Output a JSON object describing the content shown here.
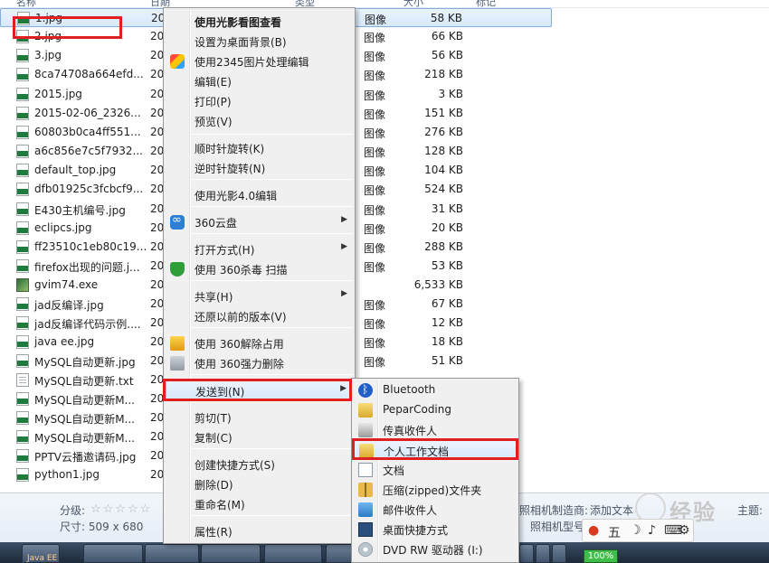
{
  "file_list": {
    "columns": [
      "名称",
      "日期",
      "类型",
      "大小",
      "标记"
    ],
    "files": [
      {
        "name": "1.jpg",
        "date": "20",
        "type": "图像",
        "size": "58 KB",
        "icon": "jpeg-file-icon"
      },
      {
        "name": "2.jpg",
        "date": "20",
        "type": "图像",
        "size": "66 KB",
        "icon": "jpeg-file-icon"
      },
      {
        "name": "3.jpg",
        "date": "20",
        "type": "图像",
        "size": "56 KB",
        "icon": "jpeg-file-icon"
      },
      {
        "name": "8ca74708a664efd...",
        "date": "20",
        "type": "图像",
        "size": "218 KB",
        "icon": "jpeg-file-icon"
      },
      {
        "name": "2015.jpg",
        "date": "20",
        "type": "图像",
        "size": "3 KB",
        "icon": "jpeg-file-icon"
      },
      {
        "name": "2015-02-06_2326...",
        "date": "20",
        "type": "图像",
        "size": "151 KB",
        "icon": "jpeg-file-icon"
      },
      {
        "name": "60803b0ca4ff551...",
        "date": "20",
        "type": "图像",
        "size": "276 KB",
        "icon": "jpeg-file-icon"
      },
      {
        "name": "a6c856e7c5f7932...",
        "date": "20",
        "type": "图像",
        "size": "128 KB",
        "icon": "jpeg-file-icon"
      },
      {
        "name": "default_top.jpg",
        "date": "20",
        "type": "图像",
        "size": "104 KB",
        "icon": "jpeg-file-icon"
      },
      {
        "name": "dfb01925c3fcbcf9...",
        "date": "20",
        "type": "图像",
        "size": "524 KB",
        "icon": "jpeg-file-icon"
      },
      {
        "name": "E430主机编号.jpg",
        "date": "20",
        "type": "图像",
        "size": "31 KB",
        "icon": "jpeg-file-icon"
      },
      {
        "name": "eclipcs.jpg",
        "date": "20",
        "type": "图像",
        "size": "20 KB",
        "icon": "jpeg-file-icon"
      },
      {
        "name": "ff23510c1eb80c19...",
        "date": "20",
        "type": "图像",
        "size": "288 KB",
        "icon": "jpeg-file-icon"
      },
      {
        "name": "firefox出现的问题.j...",
        "date": "20",
        "type": "图像",
        "size": "53 KB",
        "icon": "jpeg-file-icon"
      },
      {
        "name": "gvim74.exe",
        "date": "20",
        "type": "",
        "size": "6,533 KB",
        "icon": "exe-file-icon"
      },
      {
        "name": "jad反编译.jpg",
        "date": "20",
        "type": "图像",
        "size": "67 KB",
        "icon": "jpeg-file-icon"
      },
      {
        "name": "jad反编译代码示例....",
        "date": "20",
        "type": "图像",
        "size": "12 KB",
        "icon": "jpeg-file-icon"
      },
      {
        "name": "java ee.jpg",
        "date": "20",
        "type": "图像",
        "size": "18 KB",
        "icon": "jpeg-file-icon"
      },
      {
        "name": "MySQL自动更新.jpg",
        "date": "20",
        "type": "图像",
        "size": "51 KB",
        "icon": "jpeg-file-icon"
      },
      {
        "name": "MySQL自动更新.txt",
        "date": "20",
        "type": "",
        "size": "",
        "icon": "txt-file-icon"
      },
      {
        "name": "MySQL自动更新M...",
        "date": "20",
        "type": "",
        "size": "",
        "icon": "jpeg-file-icon"
      },
      {
        "name": "MySQL自动更新M...",
        "date": "20",
        "type": "",
        "size": "",
        "icon": "jpeg-file-icon"
      },
      {
        "name": "MySQL自动更新M...",
        "date": "20",
        "type": "",
        "size": "",
        "icon": "jpeg-file-icon"
      },
      {
        "name": "PPTV云播邀请码.jpg",
        "date": "20",
        "type": "",
        "size": "",
        "icon": "jpeg-file-icon"
      },
      {
        "name": "python1.jpg",
        "date": "20",
        "type": "",
        "size": "",
        "icon": "jpeg-file-icon"
      }
    ]
  },
  "details": {
    "rating_label": "分级:",
    "stars": "☆☆☆☆☆",
    "dimensions_label": "尺寸: 509 x 680",
    "camera_maker": "照相机制造商:",
    "camera_maker_value": "添加文本",
    "camera_model": "照相机型号:",
    "subject_label": "主题:"
  },
  "context_menu": {
    "items": [
      {
        "label": "使用光影看图查看",
        "bold": true
      },
      {
        "label": "设置为桌面背景(B)"
      },
      {
        "label": "使用2345图片处理编辑",
        "icon": "image-edit-icon"
      },
      {
        "label": "编辑(E)"
      },
      {
        "label": "打印(P)"
      },
      {
        "label": "预览(V)"
      },
      {
        "label": "顺时针旋转(K)"
      },
      {
        "label": "逆时针旋转(N)"
      },
      {
        "label": "使用光影4.0编辑"
      },
      {
        "label": "360云盘",
        "icon": "cloud-disk-icon",
        "submenu": true
      },
      {
        "label": "打开方式(H)",
        "submenu": true
      },
      {
        "label": "使用 360杀毒 扫描",
        "icon": "antivirus-shield-icon"
      },
      {
        "label": "共享(H)",
        "submenu": true
      },
      {
        "label": "还原以前的版本(V)"
      },
      {
        "label": "使用 360解除占用",
        "icon": "unlock-icon"
      },
      {
        "label": "使用 360强力删除",
        "icon": "shredder-icon"
      },
      {
        "label": "发送到(N)",
        "submenu": true,
        "highlighted": true
      },
      {
        "label": "剪切(T)"
      },
      {
        "label": "复制(C)"
      },
      {
        "label": "创建快捷方式(S)"
      },
      {
        "label": "删除(D)"
      },
      {
        "label": "重命名(M)"
      },
      {
        "label": "属性(R)"
      }
    ]
  },
  "send_to_menu": {
    "items": [
      {
        "label": "Bluetooth",
        "icon": "bluetooth-icon"
      },
      {
        "label": "PeparCoding",
        "icon": "folder-icon"
      },
      {
        "label": "传真收件人",
        "icon": "fax-icon"
      },
      {
        "label": "个人工作文档",
        "icon": "folder-icon",
        "highlighted": true
      },
      {
        "label": "文档",
        "icon": "document-icon"
      },
      {
        "label": "压缩(zipped)文件夹",
        "icon": "zip-folder-icon"
      },
      {
        "label": "邮件收件人",
        "icon": "mail-icon"
      },
      {
        "label": "桌面快捷方式",
        "icon": "desktop-icon"
      },
      {
        "label": "DVD RW 驱动器 (I:)",
        "icon": "dvd-drive-icon"
      }
    ]
  },
  "taskbar": {
    "java_ee_label": "Java EE",
    "battery": "100%"
  },
  "ime_bar": {
    "mode": "五"
  },
  "watermark": {
    "text": "经验"
  },
  "colors": {
    "highlight_red": "#e02020",
    "selection_blue": "#d6e8fb"
  }
}
